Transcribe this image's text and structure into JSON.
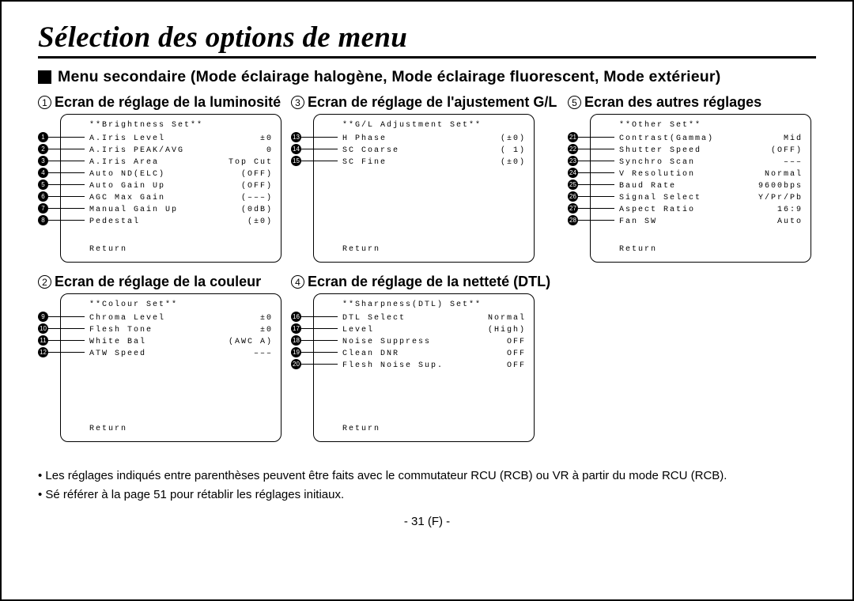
{
  "title": "Sélection des options de menu",
  "subtitle": "Menu secondaire (Mode éclairage halogène, Mode éclairage fluorescent, Mode extérieur)",
  "panels": {
    "p1": {
      "num": "1",
      "title": "Ecran de réglage de la luminosité",
      "header": "**Brightness Set**",
      "return": "Return",
      "rows": [
        {
          "n": "1",
          "label": "A.Iris Level",
          "val": "±0"
        },
        {
          "n": "2",
          "label": "A.Iris PEAK/AVG",
          "val": "0"
        },
        {
          "n": "3",
          "label": "A.Iris Area",
          "val": "Top Cut"
        },
        {
          "n": "4",
          "label": "Auto ND(ELC)",
          "val": "(OFF)"
        },
        {
          "n": "5",
          "label": "Auto Gain Up",
          "val": "(OFF)"
        },
        {
          "n": "6",
          "label": " AGC Max Gain",
          "val": "(–––)"
        },
        {
          "n": "7",
          "label": "Manual Gain Up",
          "val": "(0dB)"
        },
        {
          "n": "8",
          "label": "Pedestal",
          "val": "(±0)"
        }
      ]
    },
    "p2": {
      "num": "2",
      "title": "Ecran de réglage de la couleur",
      "header": "**Colour Set**",
      "return": "Return",
      "rows": [
        {
          "n": "9",
          "label": "Chroma Level",
          "val": "±0"
        },
        {
          "n": "10",
          "label": "Flesh Tone",
          "val": "±0"
        },
        {
          "n": "11",
          "label": "White Bal",
          "val": "(AWC A)"
        },
        {
          "n": "12",
          "label": " ATW Speed",
          "val": "–––"
        }
      ]
    },
    "p3": {
      "num": "3",
      "title": "Ecran de réglage de l'ajustement G/L",
      "header": "**G/L Adjustment Set**",
      "return": "Return",
      "rows": [
        {
          "n": "13",
          "label": "H Phase",
          "val": "(±0)"
        },
        {
          "n": "14",
          "label": "SC Coarse",
          "val": "( 1)"
        },
        {
          "n": "15",
          "label": "SC Fine",
          "val": "(±0)"
        }
      ]
    },
    "p4": {
      "num": "4",
      "title": "Ecran de réglage de la netteté (DTL)",
      "header": "**Sharpness(DTL) Set**",
      "return": "Return",
      "rows": [
        {
          "n": "16",
          "label": "DTL Select",
          "val": "Normal"
        },
        {
          "n": "17",
          "label": " Level",
          "val": "(High)"
        },
        {
          "n": "18",
          "label": "Noise Suppress",
          "val": "OFF"
        },
        {
          "n": "19",
          "label": "Clean DNR",
          "val": "OFF"
        },
        {
          "n": "20",
          "label": "Flesh Noise Sup.",
          "val": "OFF"
        }
      ]
    },
    "p5": {
      "num": "5",
      "title": "Ecran des autres réglages",
      "header": "**Other Set**",
      "return": "Return",
      "rows": [
        {
          "n": "21",
          "label": "Contrast(Gamma)",
          "val": "Mid"
        },
        {
          "n": "22",
          "label": "Shutter Speed",
          "val": "(OFF)"
        },
        {
          "n": "23",
          "label": " Synchro Scan",
          "val": "–––"
        },
        {
          "n": "24",
          "label": "V Resolution",
          "val": "Normal"
        },
        {
          "n": "25",
          "label": "Baud Rate",
          "val": "9600bps"
        },
        {
          "n": "26",
          "label": "Signal Select",
          "val": "Y/Pr/Pb"
        },
        {
          "n": "27",
          "label": "Aspect Ratio",
          "val": "16:9"
        },
        {
          "n": "28",
          "label": "Fan SW",
          "val": "Auto"
        }
      ]
    }
  },
  "notes": [
    "• Les réglages indiqués entre parenthèses peuvent être faits avec le commutateur RCU (RCB) ou VR à partir du mode RCU (RCB).",
    "• Sé référer à la page 51 pour rétablir les réglages initiaux."
  ],
  "pagenum": "- 31 (F) -"
}
